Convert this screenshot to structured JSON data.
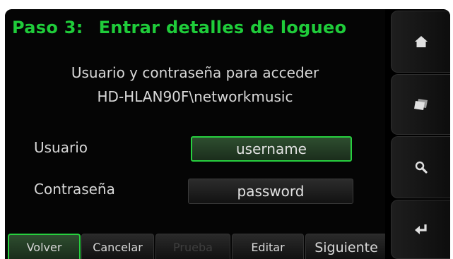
{
  "header": {
    "step": "Paso 3:",
    "title": "Entrar detalles de logueo"
  },
  "description": {
    "line1": "Usuario y contraseña para acceder",
    "line2": "HD-HLAN90F\\networkmusic"
  },
  "form": {
    "username_label": "Usuario",
    "username_value": "username",
    "password_label": "Contraseña",
    "password_value": "password"
  },
  "bottom_tabs": [
    {
      "label": "Volver",
      "state": "active"
    },
    {
      "label": "Cancelar",
      "state": "normal"
    },
    {
      "label": "Prueba",
      "state": "disabled"
    },
    {
      "label": "Editar",
      "state": "normal"
    },
    {
      "label": "Siguiente",
      "state": "normal"
    }
  ],
  "sidebar": {
    "buttons": [
      "home-icon",
      "folder-icon",
      "search-icon",
      "enter-icon"
    ]
  },
  "colors": {
    "accent": "#1fcc3a",
    "background": "#000000",
    "text": "#d8d8d8",
    "disabled_text": "#3e3e3e"
  }
}
